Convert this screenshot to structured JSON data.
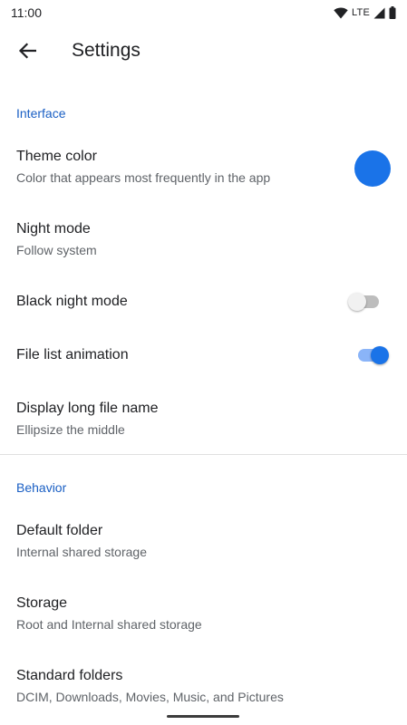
{
  "status_bar": {
    "time": "11:00",
    "network": "LTE",
    "icons": [
      "wifi-icon",
      "signal-icon",
      "battery-icon"
    ]
  },
  "app_bar": {
    "back_icon": "arrow-back-icon",
    "title": "Settings"
  },
  "colors": {
    "accent": "#1a73e8",
    "section_header": "#1a5fc4",
    "switch_on_track": "#8ab4f8",
    "switch_off_track": "#bdbdbd"
  },
  "sections": [
    {
      "header": "Interface",
      "items": [
        {
          "title": "Theme color",
          "summary": "Color that appears most frequently in the app",
          "widget": "color-swatch"
        },
        {
          "title": "Night mode",
          "summary": "Follow system"
        },
        {
          "title": "Black night mode",
          "widget": "switch",
          "checked": false
        },
        {
          "title": "File list animation",
          "widget": "switch",
          "checked": true
        },
        {
          "title": "Display long file name",
          "summary": "Ellipsize the middle"
        }
      ]
    },
    {
      "header": "Behavior",
      "items": [
        {
          "title": "Default folder",
          "summary": "Internal shared storage"
        },
        {
          "title": "Storage",
          "summary": "Root and Internal shared storage"
        },
        {
          "title": "Standard folders",
          "summary": "DCIM, Downloads, Movies, Music, and Pictures"
        }
      ]
    }
  ]
}
